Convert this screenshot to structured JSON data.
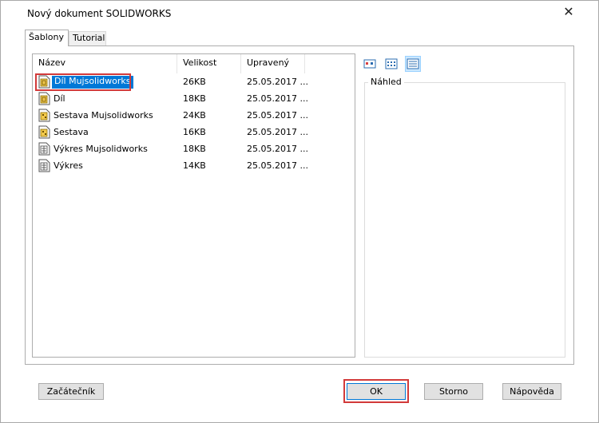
{
  "window": {
    "title": "Nový dokument SOLIDWORKS",
    "close_symbol": "✕"
  },
  "tabs": [
    {
      "label": "Šablony",
      "active": true
    },
    {
      "label": "Tutorial",
      "active": false
    }
  ],
  "list": {
    "columns": [
      "Název",
      "Velikost",
      "Upravený"
    ],
    "rows": [
      {
        "name": "Díl Mujsolidworks",
        "size": "26KB",
        "modified": "25.05.2017 ...",
        "icon": "part-icon",
        "selected": true
      },
      {
        "name": "Díl",
        "size": "18KB",
        "modified": "25.05.2017 ...",
        "icon": "part-icon",
        "selected": false
      },
      {
        "name": "Sestava Mujsolidworks",
        "size": "24KB",
        "modified": "25.05.2017 ...",
        "icon": "assembly-icon",
        "selected": false
      },
      {
        "name": "Sestava",
        "size": "16KB",
        "modified": "25.05.2017 ...",
        "icon": "assembly-icon",
        "selected": false
      },
      {
        "name": "Výkres Mujsolidworks",
        "size": "18KB",
        "modified": "25.05.2017 ...",
        "icon": "drawing-icon",
        "selected": false
      },
      {
        "name": "Výkres",
        "size": "14KB",
        "modified": "25.05.2017 ...",
        "icon": "drawing-icon",
        "selected": false
      }
    ]
  },
  "view_modes": [
    "large-icons-view-icon",
    "list-view-icon",
    "details-view-icon"
  ],
  "preview": {
    "label": "Náhled"
  },
  "buttons": {
    "beginner": "Začátečník",
    "ok": "OK",
    "cancel": "Storno",
    "help": "Nápověda"
  },
  "colors": {
    "selection": "#0078d7",
    "highlight": "#d23a3a",
    "part_icon": "#f2c94c"
  }
}
